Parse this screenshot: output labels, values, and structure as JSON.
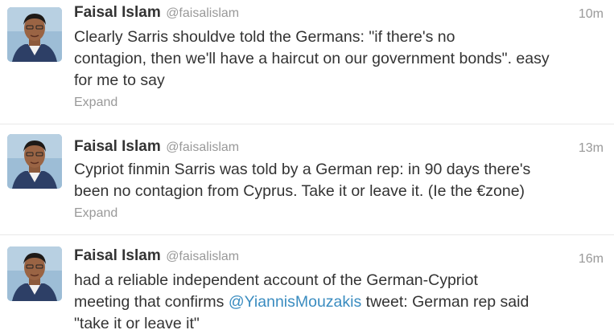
{
  "tweets": [
    {
      "fullname": "Faisal Islam",
      "username": "@faisalislam",
      "time": "10m",
      "line1": "Clearly Sarris shouldve told the Germans: \"if there's no",
      "line2": "contagion, then we'll have a haircut on our government bonds\". easy",
      "line3": "for me to say",
      "expand": "Expand"
    },
    {
      "fullname": "Faisal Islam",
      "username": "@faisalislam",
      "time": "13m",
      "line1": "Cypriot finmin Sarris was told by a German rep: in 90 days there's",
      "line2": "been no contagion from Cyprus. Take it or leave it. (Ie the €zone)",
      "expand": "Expand"
    },
    {
      "fullname": "Faisal Islam",
      "username": "@faisalislam",
      "time": "16m",
      "line1": "had a reliable independent account of the German-Cypriot",
      "line2_pre": "meeting that confirms ",
      "mention": "@YiannisMouzakis",
      "line2_post": " tweet: German rep said",
      "line3": "\"take it or leave it\""
    }
  ],
  "colors": {
    "name": "#333333",
    "meta": "#999999",
    "link": "#3a8cc0",
    "divider": "#e8e8e8"
  },
  "icons": {
    "avatar": "user-avatar-photo"
  }
}
